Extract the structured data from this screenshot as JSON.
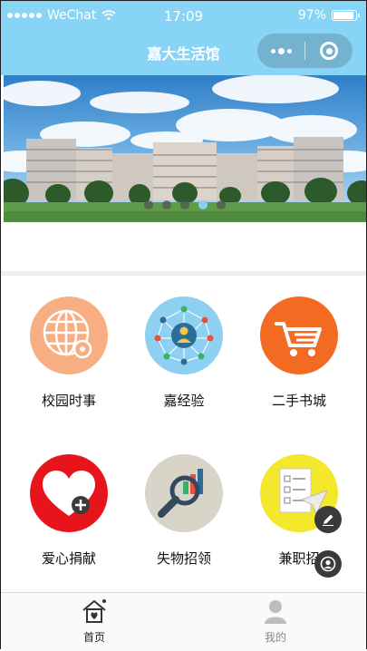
{
  "status_bar": {
    "carrier": "WeChat",
    "time": "17:09",
    "battery": "97%",
    "battery_level": 0.97
  },
  "nav": {
    "title": "嘉大生活馆"
  },
  "banner": {
    "page_count": 5,
    "active_index": 3
  },
  "grid": {
    "items": [
      {
        "label": "校园时事",
        "icon": "globe-icon",
        "bg": "#f7ae83"
      },
      {
        "label": "嘉经验",
        "icon": "network-icon",
        "bg": "#8ed0f1"
      },
      {
        "label": "二手书城",
        "icon": "shopping-cart-icon",
        "bg": "#f36a22"
      },
      {
        "label": "爱心捐献",
        "icon": "heart-plus-icon",
        "bg": "#e8141c"
      },
      {
        "label": "失物招领",
        "icon": "magnifier-chart-icon",
        "bg": "#d8d4c8"
      },
      {
        "label": "兼职招",
        "icon": "checklist-paperplane-icon",
        "bg": "#f4e82c"
      }
    ]
  },
  "fabs": {
    "edit_icon": "pencil-icon",
    "user_icon": "user-icon"
  },
  "tabbar": {
    "tabs": [
      {
        "label": "首页",
        "icon": "home-icon",
        "active": true,
        "color": "#222222"
      },
      {
        "label": "我的",
        "icon": "person-icon",
        "active": false,
        "color": "#888888"
      }
    ]
  },
  "colors": {
    "header": "#87d4f6",
    "pager_active": "#86d0ef"
  }
}
